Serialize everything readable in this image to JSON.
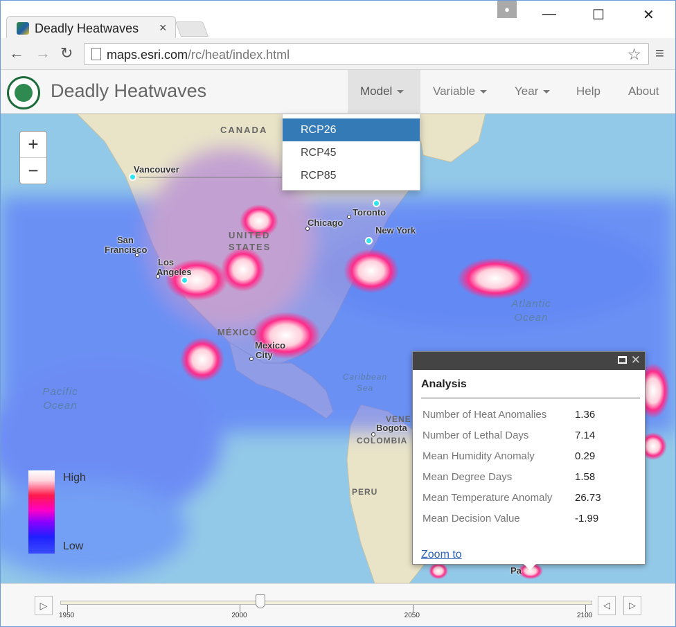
{
  "browser": {
    "tab_title": "Deadly Heatwaves",
    "tab_close": "×",
    "url_host": "maps.esri.com",
    "url_path": "/rc/heat/index.html",
    "minimize": "—",
    "maximize": "☐",
    "close": "✕"
  },
  "app": {
    "title": "Deadly Heatwaves",
    "nav": [
      "Model",
      "Variable",
      "Year",
      "Help",
      "About"
    ],
    "model_options": [
      "RCP26",
      "RCP45",
      "RCP85"
    ],
    "model_selected": "RCP26"
  },
  "map": {
    "zoom_in": "+",
    "zoom_out": "−",
    "countries": [
      "CANADA",
      "UNITED",
      "STATES",
      "MÉXICO",
      "VENE",
      "COLOMBIA",
      "PERU"
    ],
    "cities": [
      "Vancouver",
      "Toronto",
      "Chicago",
      "New York",
      "San",
      "Francisco",
      "Los",
      "Angeles",
      "Mexico",
      "City",
      "Bogota",
      "Pa"
    ],
    "oceans": {
      "pacific_1": "Pacific",
      "pacific_2": "Ocean",
      "atlantic_1": "Atlantic",
      "atlantic_2": "Ocean",
      "caribbean_1": "Caribbean",
      "caribbean_2": "Sea"
    },
    "legend": {
      "high": "High",
      "low": "Low"
    }
  },
  "popup": {
    "title": "Analysis",
    "rows": [
      {
        "label": "Number of Heat Anomalies",
        "value": "1.36"
      },
      {
        "label": "Number of Lethal Days",
        "value": "7.14"
      },
      {
        "label": "Mean Humidity Anomaly",
        "value": "0.29"
      },
      {
        "label": "Mean Degree Days",
        "value": "1.58"
      },
      {
        "label": "Mean Temperature Anomaly",
        "value": "26.73"
      },
      {
        "label": "Mean Decision Value",
        "value": "-1.99"
      }
    ],
    "zoom_link": "Zoom to"
  },
  "timeline": {
    "ticks": [
      "1950",
      "2000",
      "2050",
      "2100"
    ],
    "current_year": 2006,
    "range": [
      1950,
      2100
    ]
  }
}
